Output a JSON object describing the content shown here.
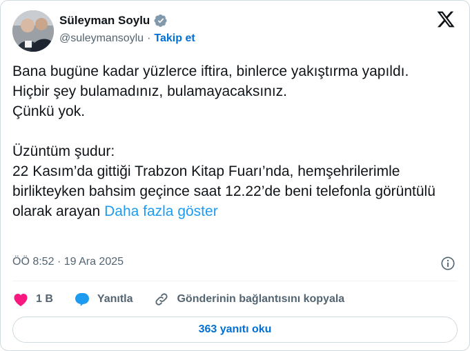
{
  "author": {
    "name": "Süleyman Soylu",
    "handle": "@suleymansoylu",
    "separator": "·",
    "follow_label": "Takip et"
  },
  "tweet": {
    "lines": [
      "Bana bugüne kadar yüzlerce iftira, binlerce yakıştırma yapıldı.",
      "Hiçbir şey bulamadınız, bulamayacaksınız.",
      "Çünkü yok.",
      "",
      "Üzüntüm şudur:",
      "22 Kasım’da gittiği Trabzon Kitap Fuarı’nda, hemşehrilerimle birlikteyken bahsim geçince saat 12.22’de beni telefonla görüntülü olarak arayan"
    ],
    "show_more": "Daha fazla göster"
  },
  "meta": {
    "time": "ÖÖ 8:52",
    "separator": "·",
    "date": "19 Ara 2025"
  },
  "actions": {
    "like_count": "1 B",
    "reply_label": "Yanıtla",
    "copy_link_label": "Gönderinin bağlantısını kopyala"
  },
  "read_replies_label": "363 yanıtı oku",
  "colors": {
    "accent": "#1d9bf0",
    "link_dark": "#006fd6",
    "like": "#f91880",
    "secondary_text": "#536471",
    "border": "#cfd9de"
  },
  "icons": [
    "verified-badge-icon",
    "x-logo-icon",
    "info-icon",
    "heart-icon",
    "reply-bubble-icon",
    "link-icon"
  ]
}
